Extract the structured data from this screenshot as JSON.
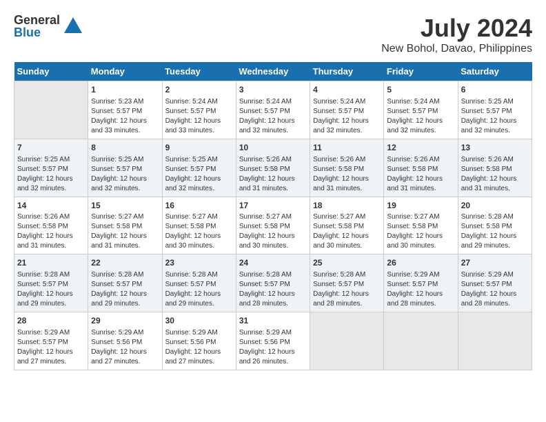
{
  "logo": {
    "general": "General",
    "blue": "Blue"
  },
  "title": "July 2024",
  "subtitle": "New Bohol, Davao, Philippines",
  "days_of_week": [
    "Sunday",
    "Monday",
    "Tuesday",
    "Wednesday",
    "Thursday",
    "Friday",
    "Saturday"
  ],
  "weeks": [
    {
      "group": 1,
      "cells": [
        {
          "day": "",
          "content": ""
        },
        {
          "day": "1",
          "content": "Sunrise: 5:23 AM\nSunset: 5:57 PM\nDaylight: 12 hours\nand 33 minutes."
        },
        {
          "day": "2",
          "content": "Sunrise: 5:24 AM\nSunset: 5:57 PM\nDaylight: 12 hours\nand 33 minutes."
        },
        {
          "day": "3",
          "content": "Sunrise: 5:24 AM\nSunset: 5:57 PM\nDaylight: 12 hours\nand 32 minutes."
        },
        {
          "day": "4",
          "content": "Sunrise: 5:24 AM\nSunset: 5:57 PM\nDaylight: 12 hours\nand 32 minutes."
        },
        {
          "day": "5",
          "content": "Sunrise: 5:24 AM\nSunset: 5:57 PM\nDaylight: 12 hours\nand 32 minutes."
        },
        {
          "day": "6",
          "content": "Sunrise: 5:25 AM\nSunset: 5:57 PM\nDaylight: 12 hours\nand 32 minutes."
        }
      ]
    },
    {
      "group": 2,
      "cells": [
        {
          "day": "7",
          "content": "Sunrise: 5:25 AM\nSunset: 5:57 PM\nDaylight: 12 hours\nand 32 minutes."
        },
        {
          "day": "8",
          "content": "Sunrise: 5:25 AM\nSunset: 5:57 PM\nDaylight: 12 hours\nand 32 minutes."
        },
        {
          "day": "9",
          "content": "Sunrise: 5:25 AM\nSunset: 5:57 PM\nDaylight: 12 hours\nand 32 minutes."
        },
        {
          "day": "10",
          "content": "Sunrise: 5:26 AM\nSunset: 5:58 PM\nDaylight: 12 hours\nand 31 minutes."
        },
        {
          "day": "11",
          "content": "Sunrise: 5:26 AM\nSunset: 5:58 PM\nDaylight: 12 hours\nand 31 minutes."
        },
        {
          "day": "12",
          "content": "Sunrise: 5:26 AM\nSunset: 5:58 PM\nDaylight: 12 hours\nand 31 minutes."
        },
        {
          "day": "13",
          "content": "Sunrise: 5:26 AM\nSunset: 5:58 PM\nDaylight: 12 hours\nand 31 minutes."
        }
      ]
    },
    {
      "group": 3,
      "cells": [
        {
          "day": "14",
          "content": "Sunrise: 5:26 AM\nSunset: 5:58 PM\nDaylight: 12 hours\nand 31 minutes."
        },
        {
          "day": "15",
          "content": "Sunrise: 5:27 AM\nSunset: 5:58 PM\nDaylight: 12 hours\nand 31 minutes."
        },
        {
          "day": "16",
          "content": "Sunrise: 5:27 AM\nSunset: 5:58 PM\nDaylight: 12 hours\nand 30 minutes."
        },
        {
          "day": "17",
          "content": "Sunrise: 5:27 AM\nSunset: 5:58 PM\nDaylight: 12 hours\nand 30 minutes."
        },
        {
          "day": "18",
          "content": "Sunrise: 5:27 AM\nSunset: 5:58 PM\nDaylight: 12 hours\nand 30 minutes."
        },
        {
          "day": "19",
          "content": "Sunrise: 5:27 AM\nSunset: 5:58 PM\nDaylight: 12 hours\nand 30 minutes."
        },
        {
          "day": "20",
          "content": "Sunrise: 5:28 AM\nSunset: 5:58 PM\nDaylight: 12 hours\nand 29 minutes."
        }
      ]
    },
    {
      "group": 4,
      "cells": [
        {
          "day": "21",
          "content": "Sunrise: 5:28 AM\nSunset: 5:57 PM\nDaylight: 12 hours\nand 29 minutes."
        },
        {
          "day": "22",
          "content": "Sunrise: 5:28 AM\nSunset: 5:57 PM\nDaylight: 12 hours\nand 29 minutes."
        },
        {
          "day": "23",
          "content": "Sunrise: 5:28 AM\nSunset: 5:57 PM\nDaylight: 12 hours\nand 29 minutes."
        },
        {
          "day": "24",
          "content": "Sunrise: 5:28 AM\nSunset: 5:57 PM\nDaylight: 12 hours\nand 28 minutes."
        },
        {
          "day": "25",
          "content": "Sunrise: 5:28 AM\nSunset: 5:57 PM\nDaylight: 12 hours\nand 28 minutes."
        },
        {
          "day": "26",
          "content": "Sunrise: 5:29 AM\nSunset: 5:57 PM\nDaylight: 12 hours\nand 28 minutes."
        },
        {
          "day": "27",
          "content": "Sunrise: 5:29 AM\nSunset: 5:57 PM\nDaylight: 12 hours\nand 28 minutes."
        }
      ]
    },
    {
      "group": 5,
      "cells": [
        {
          "day": "28",
          "content": "Sunrise: 5:29 AM\nSunset: 5:57 PM\nDaylight: 12 hours\nand 27 minutes."
        },
        {
          "day": "29",
          "content": "Sunrise: 5:29 AM\nSunset: 5:56 PM\nDaylight: 12 hours\nand 27 minutes."
        },
        {
          "day": "30",
          "content": "Sunrise: 5:29 AM\nSunset: 5:56 PM\nDaylight: 12 hours\nand 27 minutes."
        },
        {
          "day": "31",
          "content": "Sunrise: 5:29 AM\nSunset: 5:56 PM\nDaylight: 12 hours\nand 26 minutes."
        },
        {
          "day": "",
          "content": ""
        },
        {
          "day": "",
          "content": ""
        },
        {
          "day": "",
          "content": ""
        }
      ]
    }
  ]
}
